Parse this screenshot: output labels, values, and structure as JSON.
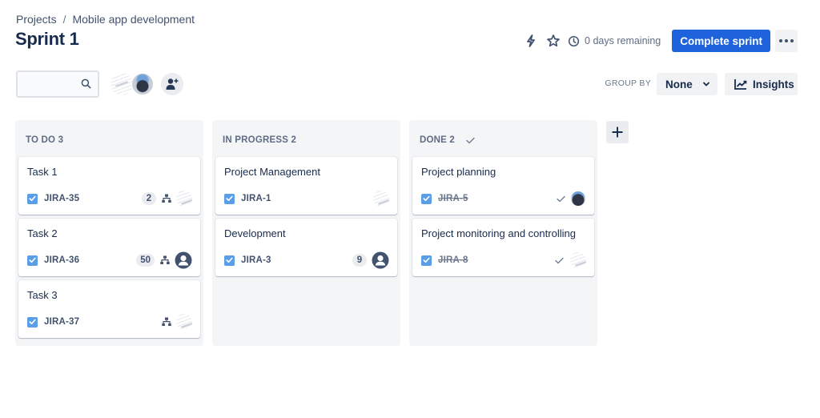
{
  "breadcrumb": {
    "items": [
      "Projects",
      "Mobile app development"
    ],
    "separator": "/"
  },
  "page": {
    "title": "Sprint 1"
  },
  "header": {
    "lightning_icon": "lightning-icon",
    "star_icon": "star-icon",
    "clock_icon": "clock-icon",
    "remaining_label": "0 days remaining",
    "complete_sprint_label": "Complete sprint",
    "more_icon": "more-horizontal-icon",
    "primary_color": "#1f63dc"
  },
  "toolbar": {
    "search": {
      "value": "",
      "placeholder": "",
      "icon": "search-icon"
    },
    "add_people_icon": "add-person-icon",
    "group_by_label": "GROUP BY",
    "group_by_value": "None",
    "insights_label": "Insights",
    "insights_icon": "chart-trend-icon"
  },
  "columns": [
    {
      "name": "TO DO 3",
      "done_marker": false,
      "cards": [
        {
          "title": "Task 1",
          "key": "JIRA-35",
          "done": false,
          "estimate": "2",
          "has_child_icon": true,
          "assignee": "sketch"
        },
        {
          "title": "Task 2",
          "key": "JIRA-36",
          "done": false,
          "estimate": "50",
          "has_child_icon": true,
          "assignee": "generic"
        },
        {
          "title": "Task 3",
          "key": "JIRA-37",
          "done": false,
          "estimate": null,
          "has_child_icon": true,
          "assignee": "sketch"
        }
      ]
    },
    {
      "name": "IN PROGRESS 2",
      "done_marker": false,
      "cards": [
        {
          "title": "Project Management",
          "key": "JIRA-1",
          "done": false,
          "estimate": null,
          "has_child_icon": false,
          "assignee": "sketch"
        },
        {
          "title": "Development",
          "key": "JIRA-3",
          "done": false,
          "estimate": "9",
          "has_child_icon": false,
          "assignee": "generic"
        }
      ]
    },
    {
      "name": "DONE 2",
      "done_marker": true,
      "cards": [
        {
          "title": "Project planning",
          "key": "JIRA-5",
          "done": true,
          "estimate": null,
          "has_child_icon": false,
          "assignee": "photo"
        },
        {
          "title": "Project monitoring and controlling",
          "key": "JIRA-8",
          "done": true,
          "estimate": null,
          "has_child_icon": false,
          "assignee": "sketch"
        }
      ]
    }
  ],
  "add_column_icon": "plus-icon"
}
